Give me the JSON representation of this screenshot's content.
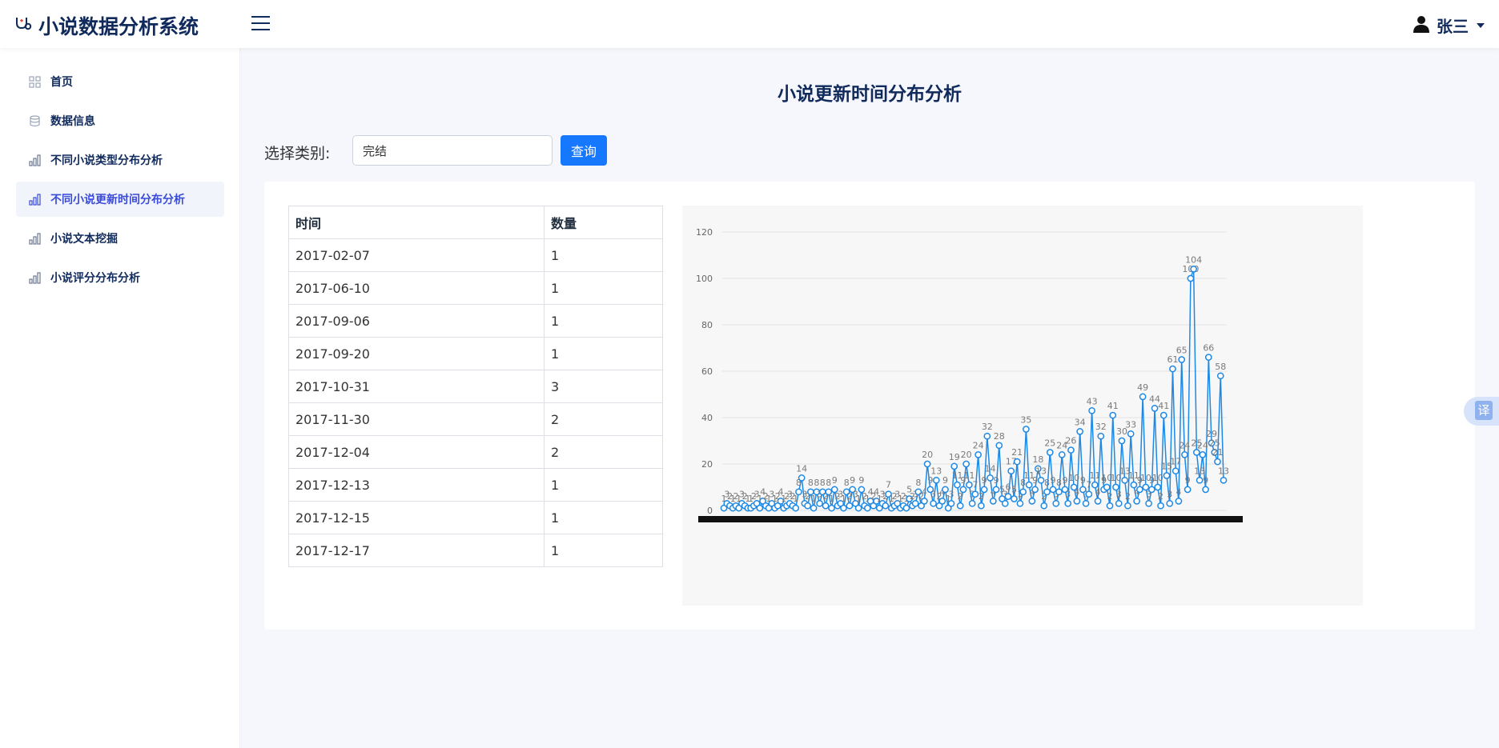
{
  "app": {
    "title": "小说数据分析系统",
    "user_name": "张三"
  },
  "sidebar": {
    "items": [
      {
        "label": "首页",
        "icon": "grid-icon"
      },
      {
        "label": "数据信息",
        "icon": "database-icon"
      },
      {
        "label": "不同小说类型分布分析",
        "icon": "bar-chart-icon"
      },
      {
        "label": "不同小说更新时间分布分析",
        "icon": "bar-chart-icon",
        "active": true
      },
      {
        "label": "小说文本挖掘",
        "icon": "bar-chart-icon"
      },
      {
        "label": "小说评分分布分析",
        "icon": "bar-chart-icon"
      }
    ]
  },
  "main": {
    "title": "小说更新时间分布分析",
    "filter_label": "选择类别:",
    "filter_value": "完结",
    "query_label": "查询",
    "table": {
      "headers": [
        "时间",
        "数量"
      ],
      "rows": [
        [
          "2017-02-07",
          "1"
        ],
        [
          "2017-06-10",
          "1"
        ],
        [
          "2017-09-06",
          "1"
        ],
        [
          "2017-09-20",
          "1"
        ],
        [
          "2017-10-31",
          "3"
        ],
        [
          "2017-11-30",
          "2"
        ],
        [
          "2017-12-04",
          "2"
        ],
        [
          "2017-12-13",
          "1"
        ],
        [
          "2017-12-15",
          "1"
        ],
        [
          "2017-12-17",
          "1"
        ]
      ]
    }
  },
  "translate_label": "译",
  "colors": {
    "primary": "#1677ff",
    "brand": "#102a5c",
    "series": "#1e88e5"
  },
  "chart_data": {
    "type": "line",
    "ylim": [
      0,
      120
    ],
    "yticks": [
      0,
      20,
      40,
      60,
      80,
      100,
      120
    ],
    "series": [
      {
        "values": [
          1,
          3,
          2,
          1,
          2,
          1,
          3,
          2,
          1,
          1,
          2,
          3,
          1,
          4,
          2,
          1,
          3,
          1,
          2,
          4,
          1,
          2,
          3,
          2,
          1,
          8,
          14,
          3,
          2,
          8,
          1,
          8,
          3,
          8,
          2,
          8,
          1,
          9,
          2,
          3,
          1,
          8,
          2,
          9,
          3,
          1,
          9,
          2,
          1,
          4,
          2,
          4,
          1,
          3,
          2,
          7,
          1,
          2,
          3,
          1,
          2,
          1,
          5,
          2,
          3,
          8,
          2,
          4,
          20,
          9,
          3,
          13,
          2,
          4,
          9,
          1,
          3,
          19,
          11,
          2,
          9,
          20,
          11,
          3,
          7,
          24,
          2,
          9,
          32,
          14,
          4,
          9,
          28,
          5,
          3,
          6,
          17,
          5,
          21,
          3,
          8,
          35,
          11,
          4,
          9,
          18,
          13,
          2,
          8,
          25,
          9,
          3,
          8,
          24,
          9,
          3,
          26,
          10,
          4,
          34,
          9,
          3,
          7,
          43,
          11,
          4,
          32,
          9,
          10,
          2,
          41,
          10,
          3,
          30,
          13,
          2,
          33,
          11,
          4,
          9,
          49,
          10,
          3,
          9,
          44,
          10,
          2,
          41,
          15,
          3,
          61,
          17,
          4,
          65,
          24,
          9,
          100,
          104,
          25,
          13,
          24,
          9,
          66,
          29,
          25,
          21,
          58,
          13
        ]
      }
    ]
  }
}
